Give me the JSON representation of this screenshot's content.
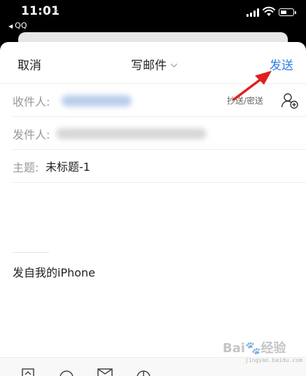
{
  "status_bar": {
    "time": "11:01",
    "back_app": "QQ"
  },
  "nav": {
    "cancel_label": "取消",
    "title": "写邮件",
    "send_label": "发送"
  },
  "fields": {
    "to_label": "收件人:",
    "cc_bcc_label": "抄送/密送",
    "from_label": "发件人:",
    "subject_label": "主题:",
    "subject_value": "未标题-1"
  },
  "body": {
    "signature": "发自我的iPhone"
  },
  "colors": {
    "accent": "#2b7de9",
    "annotation_arrow": "#e02020"
  },
  "icons": [
    "location-arrow-icon",
    "signal-icon",
    "wifi-icon",
    "battery-icon",
    "chevron-down-icon",
    "add-contact-icon",
    "attachment-icon",
    "emoji-icon",
    "mail-icon",
    "clock-icon"
  ]
}
